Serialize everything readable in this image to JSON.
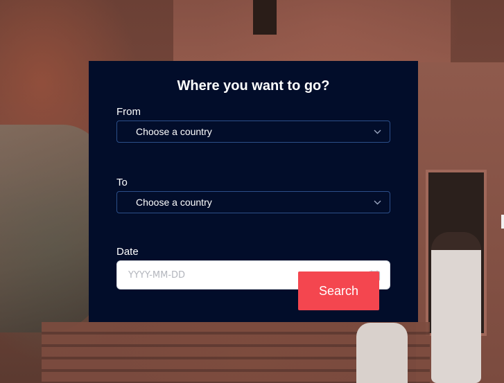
{
  "form": {
    "title": "Where you want to go?",
    "from": {
      "label": "From",
      "selected": "Choose a country"
    },
    "to": {
      "label": "To",
      "selected": "Choose a country"
    },
    "date": {
      "label": "Date",
      "placeholder": "YYYY-MM-DD",
      "value": ""
    },
    "search_label": "Search"
  },
  "icons": {
    "select_chevron": "chevron-down-icon",
    "date_picker": "calendar-icon"
  },
  "colors": {
    "card_background": "#020d2a",
    "select_border": "#2c4f8a",
    "search_button": "#f4464f",
    "text": "#ffffff"
  }
}
